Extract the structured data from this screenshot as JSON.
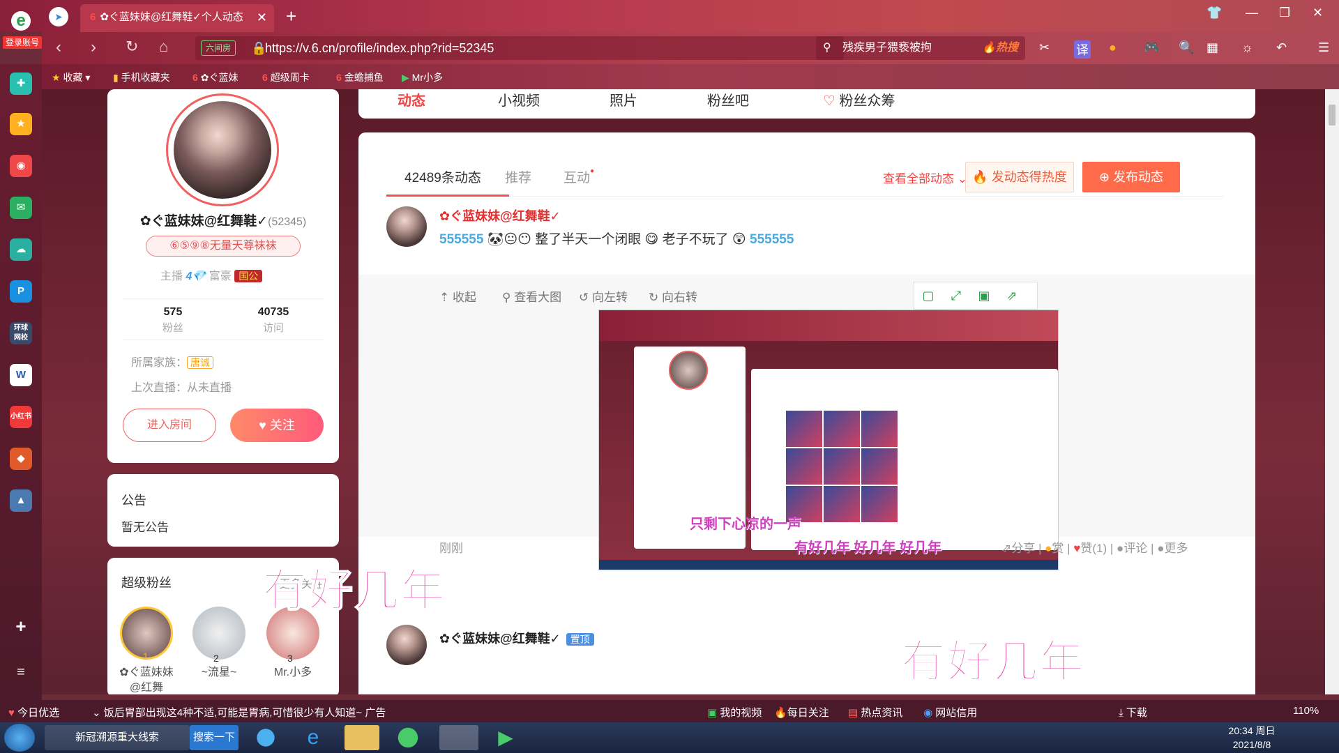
{
  "browser": {
    "logo_label": "登录账号",
    "tab_title": "✿ぐ蓝妹妹@红舞鞋✓个人动态",
    "url": "https://v.6.cn/profile/index.php?rid=52345",
    "url_badge": "六间房",
    "search_text": "残疾男子猥亵被拘",
    "search_hot": "🔥热搜"
  },
  "bookmarks": [
    {
      "label": "收藏"
    },
    {
      "label": "手机收藏夹"
    },
    {
      "label": "✿ぐ蓝妹"
    },
    {
      "label": "超级周卡"
    },
    {
      "label": "金蟾捕鱼"
    },
    {
      "label": "Mr小多"
    }
  ],
  "profile": {
    "name": "✿ぐ蓝妹妹@红舞鞋✓",
    "rid": "(52345)",
    "title_tag": "⑥⑤⑨⑧无量天尊袜袜",
    "rank_anchor": "主播",
    "rank_rich": "富豪",
    "rank_badge": "国公",
    "fans_count": "575",
    "fans_label": "粉丝",
    "visits_count": "40735",
    "visits_label": "访问",
    "family_label": "所属家族：",
    "family_value": "唐诚",
    "last_live": "上次直播：从未直播",
    "enter_room": "进入房间",
    "follow": "关注"
  },
  "notice": {
    "title": "公告",
    "text": "暂无公告"
  },
  "super_fans": {
    "title": "超级粉丝",
    "more": "更多关注",
    "fans": [
      {
        "rank": "1",
        "name": "✿ぐ蓝妹妹@红舞"
      },
      {
        "rank": "2",
        "name": "~流星~"
      },
      {
        "rank": "3",
        "name": "Mr.小多"
      }
    ]
  },
  "nav_tabs": [
    "动态",
    "小视频",
    "照片",
    "粉丝吧",
    "粉丝众筹"
  ],
  "feed": {
    "tabs": [
      "42489条动态",
      "推荐",
      "互动"
    ],
    "view_all": "查看全部动态 ⌄",
    "hot_btn": "发动态得热度",
    "publish_btn": "发布动态",
    "post1": {
      "name": "✿ぐ蓝妹妹@红舞鞋✓",
      "text": "整了半天一个闭眼",
      "text2": "老子不玩了"
    },
    "img_tools": [
      "收起",
      "查看大图",
      "向左转",
      "向右转"
    ],
    "time": "刚刚",
    "actions": [
      "分享",
      "赏",
      "赞(1)",
      "评论",
      "更多"
    ],
    "screenshot_overlay1": "只剩下心凉的一声",
    "screenshot_overlay2": "有好几年 好几年 好几年",
    "post2": {
      "name": "✿ぐ蓝妹妹@红舞鞋✓",
      "pin": "置顶"
    }
  },
  "overlay_text": "有好几年",
  "statusbar": {
    "left1": "今日优选",
    "news": "饭后胃部出现这4种不适,可能是胃病,可惜很少有人知道~ 广告",
    "items": [
      "我的视频",
      "每日关注",
      "热点资讯",
      "网站信用",
      "下载"
    ],
    "zoom": "110%"
  },
  "taskbar": {
    "ie_label": "新冠溯源重大线索",
    "search_btn": "搜索一下",
    "time": "20:34 周日",
    "date": "2021/8/8"
  }
}
